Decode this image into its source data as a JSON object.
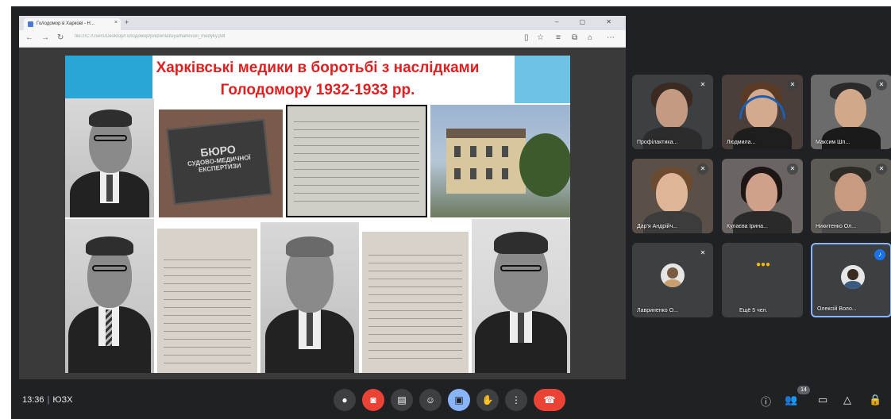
{
  "browser": {
    "tab_title": "Голодомор в Харкові - Н...",
    "tab_close": "×",
    "new_tab": "+",
    "window_controls": "– ▢ ✕",
    "url": "file:///C:/Users/Desktop/Голодомор/prezentatsiya/harkivski_medyky.pdf",
    "icons": [
      "back-icon",
      "forward-icon",
      "refresh-icon",
      "bookmark-icon",
      "favorites-icon",
      "collections-icon",
      "share-icon",
      "menu-icon"
    ]
  },
  "slide": {
    "title_line1": "Харківські медики в боротьбі з наслідками",
    "title_line2": "Голодомору 1932-1933 рр.",
    "plaque_line1": "БЮРО",
    "plaque_line2": "СУДОВО-МЕДИЧНОЇ",
    "plaque_line3": "ЕКСПЕРТИЗИ"
  },
  "participants": [
    {
      "name": "Профілактика...",
      "mic": "muted"
    },
    {
      "name": "Людмила...",
      "mic": "muted"
    },
    {
      "name": "Максим Шп...",
      "mic": "muted"
    },
    {
      "name": "Дар'я Андрійч...",
      "mic": "muted"
    },
    {
      "name": "Кулаєва Ірина...",
      "mic": "muted"
    },
    {
      "name": "Никитенко Ол...",
      "mic": "muted"
    },
    {
      "name": "Лавриненко О...",
      "mic": "muted"
    },
    {
      "name": "Ещё 5 чел.",
      "mic": "none"
    },
    {
      "name": "Олексій Воло...",
      "mic": "speaking"
    }
  ],
  "bottom_bar": {
    "time": "13:36",
    "separator": "|",
    "meeting_code": "ЮЗХ",
    "people_count": "14",
    "controls": [
      "mic-icon",
      "camera-off-icon",
      "captions-icon",
      "emoji-icon",
      "present-icon",
      "raise-hand-icon",
      "more-options-icon",
      "hang-up-icon"
    ],
    "right_controls": [
      "info-icon",
      "people-icon",
      "chat-icon",
      "activities-icon",
      "host-controls-icon"
    ]
  },
  "colors": {
    "meet_bg": "#202124",
    "title_red": "#e02020",
    "accent_blue": "#8ab4f8",
    "danger_red": "#ea4335"
  }
}
